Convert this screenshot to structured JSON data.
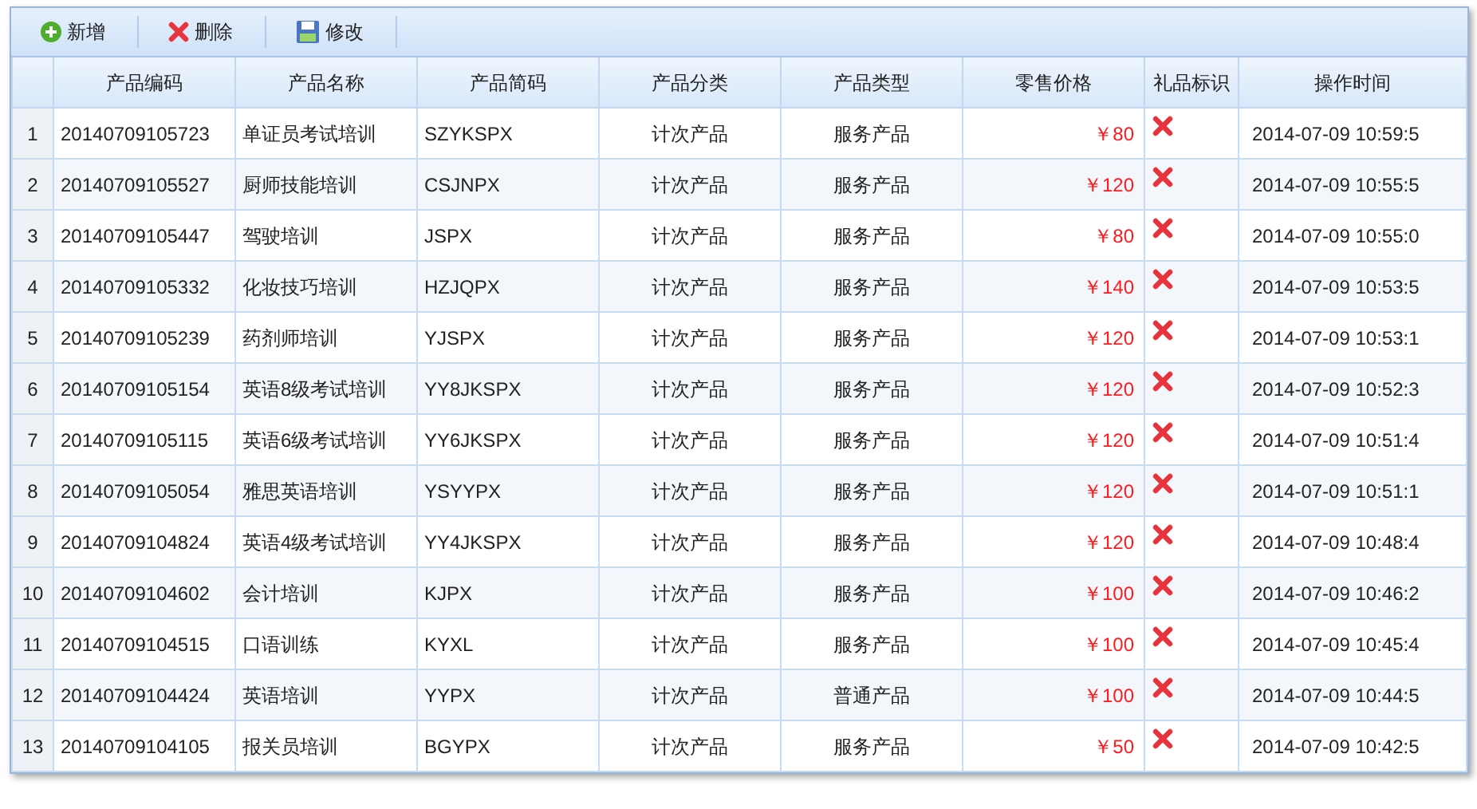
{
  "toolbar": [
    {
      "kind": "add",
      "label": "新增"
    },
    {
      "kind": "delete",
      "label": "删除"
    },
    {
      "kind": "edit",
      "label": "修改"
    }
  ],
  "table": {
    "columns": [
      "产品编码",
      "产品名称",
      "产品简码",
      "产品分类",
      "产品类型",
      "零售价格",
      "礼品标识",
      "操作时间"
    ],
    "rows": [
      {
        "num": "1",
        "code": "20140709105723",
        "name": "单证员考试培训",
        "abbr": "SZYKSPX",
        "category": "计次产品",
        "type": "服务产品",
        "price": "￥80",
        "gift": false,
        "time": "2014-07-09 10:59:5"
      },
      {
        "num": "2",
        "code": "20140709105527",
        "name": "厨师技能培训",
        "abbr": "CSJNPX",
        "category": "计次产品",
        "type": "服务产品",
        "price": "￥120",
        "gift": false,
        "time": "2014-07-09 10:55:5"
      },
      {
        "num": "3",
        "code": "20140709105447",
        "name": "驾驶培训",
        "abbr": "JSPX",
        "category": "计次产品",
        "type": "服务产品",
        "price": "￥80",
        "gift": false,
        "time": "2014-07-09 10:55:0"
      },
      {
        "num": "4",
        "code": "20140709105332",
        "name": "化妆技巧培训",
        "abbr": "HZJQPX",
        "category": "计次产品",
        "type": "服务产品",
        "price": "￥140",
        "gift": false,
        "time": "2014-07-09 10:53:5"
      },
      {
        "num": "5",
        "code": "20140709105239",
        "name": "药剂师培训",
        "abbr": "YJSPX",
        "category": "计次产品",
        "type": "服务产品",
        "price": "￥120",
        "gift": false,
        "time": "2014-07-09 10:53:1"
      },
      {
        "num": "6",
        "code": "20140709105154",
        "name": "英语8级考试培训",
        "abbr": "YY8JKSPX",
        "category": "计次产品",
        "type": "服务产品",
        "price": "￥120",
        "gift": false,
        "time": "2014-07-09 10:52:3"
      },
      {
        "num": "7",
        "code": "20140709105115",
        "name": "英语6级考试培训",
        "abbr": "YY6JKSPX",
        "category": "计次产品",
        "type": "服务产品",
        "price": "￥120",
        "gift": false,
        "time": "2014-07-09 10:51:4"
      },
      {
        "num": "8",
        "code": "20140709105054",
        "name": "雅思英语培训",
        "abbr": "YSYYPX",
        "category": "计次产品",
        "type": "服务产品",
        "price": "￥120",
        "gift": false,
        "time": "2014-07-09 10:51:1"
      },
      {
        "num": "9",
        "code": "20140709104824",
        "name": "英语4级考试培训",
        "abbr": "YY4JKSPX",
        "category": "计次产品",
        "type": "服务产品",
        "price": "￥120",
        "gift": false,
        "time": "2014-07-09 10:48:4"
      },
      {
        "num": "10",
        "code": "20140709104602",
        "name": "会计培训",
        "abbr": "KJPX",
        "category": "计次产品",
        "type": "服务产品",
        "price": "￥100",
        "gift": false,
        "time": "2014-07-09 10:46:2"
      },
      {
        "num": "11",
        "code": "20140709104515",
        "name": "口语训练",
        "abbr": "KYXL",
        "category": "计次产品",
        "type": "服务产品",
        "price": "￥100",
        "gift": false,
        "time": "2014-07-09 10:45:4"
      },
      {
        "num": "12",
        "code": "20140709104424",
        "name": "英语培训",
        "abbr": "YYPX",
        "category": "计次产品",
        "type": "普通产品",
        "price": "￥100",
        "gift": false,
        "time": "2014-07-09 10:44:5"
      },
      {
        "num": "13",
        "code": "20140709104105",
        "name": "报关员培训",
        "abbr": "BGYPX",
        "category": "计次产品",
        "type": "服务产品",
        "price": "￥50",
        "gift": false,
        "time": "2014-07-09 10:42:5"
      }
    ]
  }
}
